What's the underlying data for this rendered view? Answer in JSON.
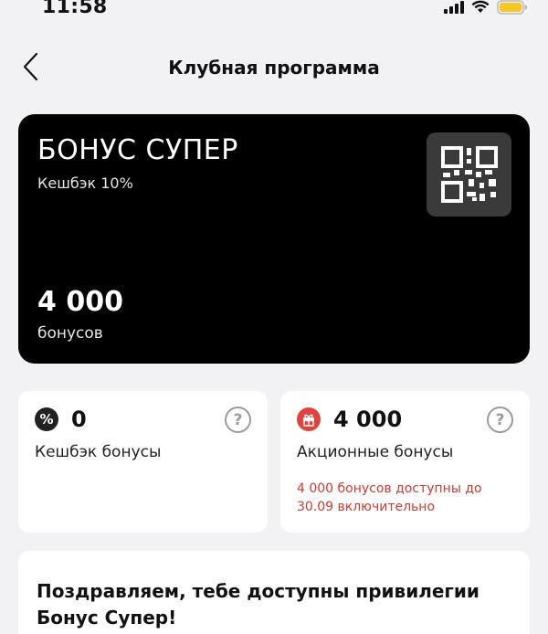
{
  "status_bar": {
    "time": "11:58",
    "icons": [
      "signal-icon",
      "wifi-icon",
      "battery-icon"
    ],
    "battery_color": "#f7c928"
  },
  "nav": {
    "back_icon": "chevron-left-icon",
    "title": "Клубная программа"
  },
  "card": {
    "name": "БОНУС СУПЕР",
    "cashback": "Кешбэк 10%",
    "amount": "4 000",
    "unit": "бонусов",
    "background": "#000000",
    "qr_icon": "qr-code-icon"
  },
  "tiles": [
    {
      "icon": "percent-icon",
      "icon_glyph": "%",
      "value": "0",
      "label": "Кешбэк бонусы",
      "help": "?"
    },
    {
      "icon": "gift-icon",
      "value": "4 000",
      "label": "Акционные бонусы",
      "help": "?",
      "note": "4 000 бонусов доступны до 30.09 включительно",
      "accent": "#e0433b"
    }
  ],
  "promo": {
    "text": "Поздравляем, тебе доступны привилегии Бонус Супер!"
  }
}
